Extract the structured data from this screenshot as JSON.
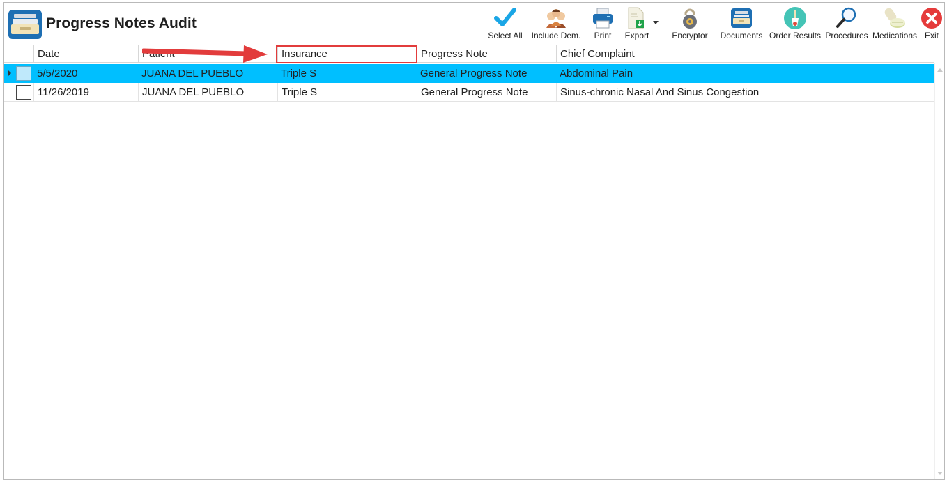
{
  "app": {
    "title": "Progress Notes Audit"
  },
  "toolbar": [
    {
      "name": "select-all-button",
      "icon": "checkmark-icon",
      "label": "Select All"
    },
    {
      "name": "include-dem-button",
      "icon": "people-icon",
      "label": "Include Dem."
    },
    {
      "name": "print-button",
      "icon": "printer-icon",
      "label": "Print"
    },
    {
      "name": "export-button",
      "icon": "export-file-icon",
      "label": "Export"
    },
    {
      "name": "encryptor-button",
      "icon": "lock-icon",
      "label": "Encryptor"
    },
    {
      "name": "documents-button",
      "icon": "document-tray-icon",
      "label": "Documents"
    },
    {
      "name": "order-results-button",
      "icon": "microscope-icon",
      "label": "Order Results"
    },
    {
      "name": "procedures-button",
      "icon": "magnifier-icon",
      "label": "Procedures"
    },
    {
      "name": "medications-button",
      "icon": "pills-icon",
      "label": "Medications"
    },
    {
      "name": "exit-button",
      "icon": "close-circle-icon",
      "label": "Exit"
    }
  ],
  "grid": {
    "columns": [
      "Date",
      "Patient",
      "Insurance",
      "Progress Note",
      "Chief Complaint"
    ],
    "rows": [
      {
        "date": "5/5/2020",
        "patient": "JUANA  DEL PUEBLO",
        "insurance": "Triple S",
        "note": "General Progress Note",
        "complaint": "Abdominal Pain",
        "selected": true
      },
      {
        "date": "11/26/2019",
        "patient": "JUANA  DEL PUEBLO",
        "insurance": "Triple S",
        "note": "General Progress Note",
        "complaint": "Sinus-chronic  Nasal And Sinus Congestion",
        "selected": false
      }
    ]
  },
  "colors": {
    "selection": "#00bfff",
    "annotation": "#e23c3c",
    "brand": "#1e6fb3"
  }
}
